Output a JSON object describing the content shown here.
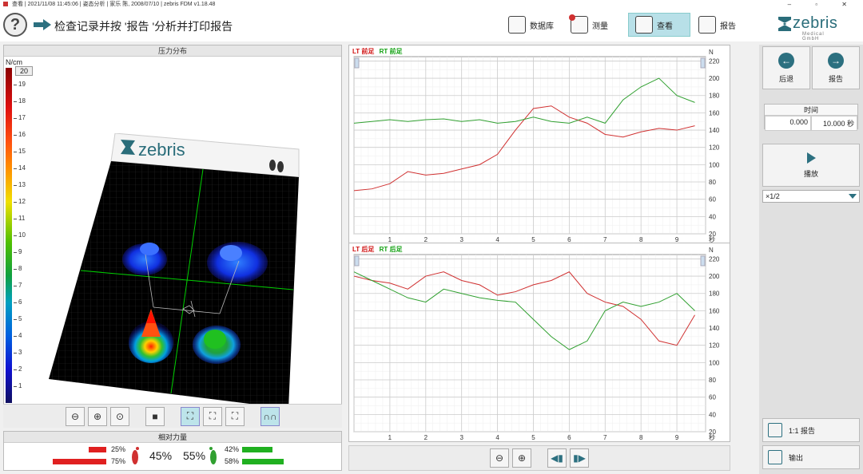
{
  "window": {
    "title": "查看 | 2021/11/08 11:45:06 | 姿态分析 | 家乐 陈, 2008/07/10 | zebris FDM v1.18.48",
    "controls": "–   ▫   ✕"
  },
  "toolbar": {
    "help_label": "?",
    "instruction": "检查记录并按 '报告 '分析并打印报告",
    "nav": [
      {
        "label": "数据库"
      },
      {
        "label": "测量"
      },
      {
        "label": "查看"
      },
      {
        "label": "报告"
      }
    ],
    "logo_name": "zebris",
    "logo_sub": "Medical GmbH"
  },
  "pressure": {
    "header": "压力分布",
    "unit": "N/cm",
    "max_value": "20",
    "scale_ticks": [
      "19",
      "18",
      "17",
      "16",
      "15",
      "14",
      "13",
      "12",
      "11",
      "10",
      "9",
      "8",
      "7",
      "6",
      "5",
      "4",
      "3",
      "2",
      "1"
    ],
    "plate_logo": "zebris"
  },
  "relative_force": {
    "header": "相对力量",
    "left_fore": "25%",
    "left_rear": "75%",
    "left_total": "45%",
    "right_total": "55%",
    "right_fore": "42%",
    "right_rear": "58%",
    "left_fore_frac": 0.25,
    "left_rear_frac": 0.75,
    "right_fore_frac": 0.42,
    "right_rear_frac": 0.58
  },
  "charts": {
    "top_lt": "LT 前足",
    "top_rt": "RT 前足",
    "bottom_lt": "LT 后足",
    "bottom_rt": "RT 后足",
    "unit_n": "N",
    "unit_s": "秒"
  },
  "right": {
    "back_label": "后退",
    "report_label": "报告",
    "time_label": "时间",
    "time_start": "0.000",
    "time_end": "10.000 秒",
    "play_label": "播放",
    "speed": "×1/2",
    "report11_label": "1:1 报告",
    "export_label": "输出"
  },
  "chart_data": [
    {
      "type": "line",
      "series": [
        {
          "name": "LT 前足",
          "color": "#d03030",
          "x": [
            0,
            0.5,
            1,
            1.5,
            2,
            2.5,
            3,
            3.5,
            4,
            4.5,
            5,
            5.5,
            6,
            6.5,
            7,
            7.5,
            8,
            8.5,
            9,
            9.5
          ],
          "y": [
            70,
            72,
            78,
            92,
            88,
            90,
            95,
            100,
            112,
            140,
            165,
            168,
            155,
            148,
            135,
            132,
            138,
            142,
            140,
            145
          ]
        },
        {
          "name": "RT 前足",
          "color": "#30a030",
          "x": [
            0,
            0.5,
            1,
            1.5,
            2,
            2.5,
            3,
            3.5,
            4,
            4.5,
            5,
            5.5,
            6,
            6.5,
            7,
            7.5,
            8,
            8.5,
            9,
            9.5
          ],
          "y": [
            148,
            150,
            152,
            150,
            152,
            153,
            150,
            152,
            148,
            150,
            155,
            150,
            148,
            155,
            148,
            175,
            190,
            200,
            180,
            172
          ]
        }
      ],
      "xlim": [
        0,
        9.8
      ],
      "ylim": [
        20,
        225
      ],
      "yticks": [
        20,
        40,
        60,
        80,
        100,
        120,
        140,
        160,
        180,
        200,
        220
      ],
      "xticks": [
        1,
        2,
        3,
        4,
        5,
        6,
        7,
        8,
        9
      ]
    },
    {
      "type": "line",
      "series": [
        {
          "name": "LT 后足",
          "color": "#d03030",
          "x": [
            0,
            0.5,
            1,
            1.5,
            2,
            2.5,
            3,
            3.5,
            4,
            4.5,
            5,
            5.5,
            6,
            6.5,
            7,
            7.5,
            8,
            8.5,
            9,
            9.5
          ],
          "y": [
            200,
            195,
            192,
            185,
            200,
            205,
            195,
            190,
            178,
            182,
            190,
            195,
            205,
            180,
            170,
            165,
            150,
            125,
            120,
            155
          ]
        },
        {
          "name": "RT 后足",
          "color": "#30a030",
          "x": [
            0,
            0.5,
            1,
            1.5,
            2,
            2.5,
            3,
            3.5,
            4,
            4.5,
            5,
            5.5,
            6,
            6.5,
            7,
            7.5,
            8,
            8.5,
            9,
            9.5
          ],
          "y": [
            205,
            195,
            185,
            175,
            170,
            185,
            180,
            175,
            172,
            170,
            150,
            130,
            115,
            125,
            160,
            170,
            165,
            170,
            180,
            160
          ]
        }
      ],
      "xlim": [
        0,
        9.8
      ],
      "ylim": [
        20,
        225
      ],
      "yticks": [
        20,
        40,
        60,
        80,
        100,
        120,
        140,
        160,
        180,
        200,
        220
      ],
      "xticks": [
        1,
        2,
        3,
        4,
        5,
        6,
        7,
        8,
        9
      ]
    }
  ]
}
